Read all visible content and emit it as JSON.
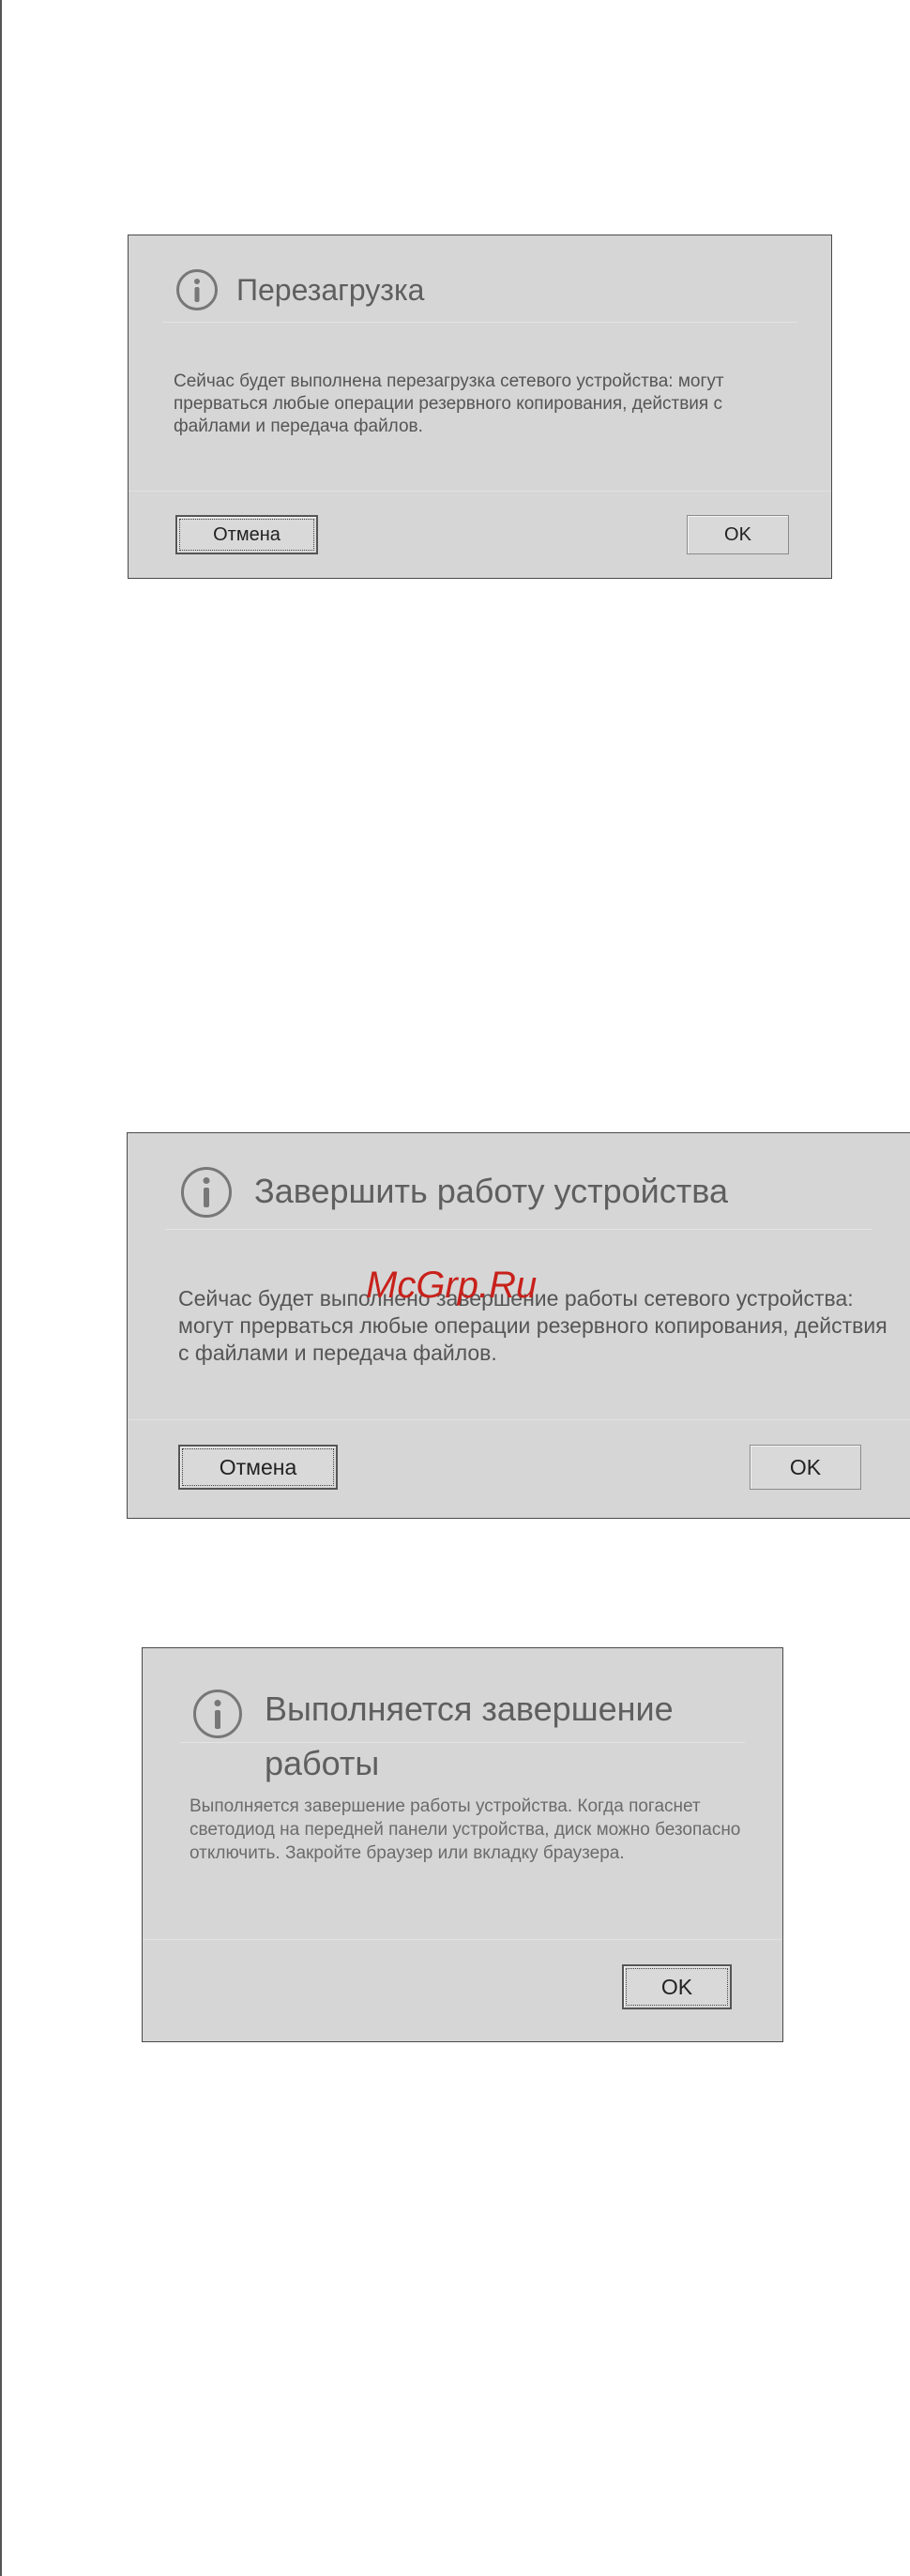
{
  "watermark": "McGrp.Ru",
  "dialogs": {
    "restart": {
      "icon": "info-icon",
      "title": "Перезагрузка",
      "message": "Сейчас будет выполнена перезагрузка сетевого устройства: могут прерваться любые операции резервного копирования, действия с файлами и передача файлов.",
      "cancel_label": "Отмена",
      "ok_label": "OK"
    },
    "shutdown": {
      "icon": "info-icon",
      "title": "Завершить работу устройства",
      "message": "Сейчас будет выполнено завершение работы сетевого устройства: могут прерваться любые операции резервного копирования, действия с файлами и передача файлов.",
      "cancel_label": "Отмена",
      "ok_label": "OK"
    },
    "shutdown_progress": {
      "icon": "info-icon",
      "title": "Выполняется завершение работы",
      "message": "Выполняется завершение работы устройства. Когда погаснет светодиод на передней панели устройства, диск можно безопасно отключить. Закройте браузер или вкладку браузера.",
      "ok_label": "OK"
    }
  },
  "colors": {
    "dialog_background": "#d6d6d6",
    "dialog_border": "#4a4a4a",
    "title_text": "#5f5f5f",
    "watermark": "#c8211b"
  }
}
